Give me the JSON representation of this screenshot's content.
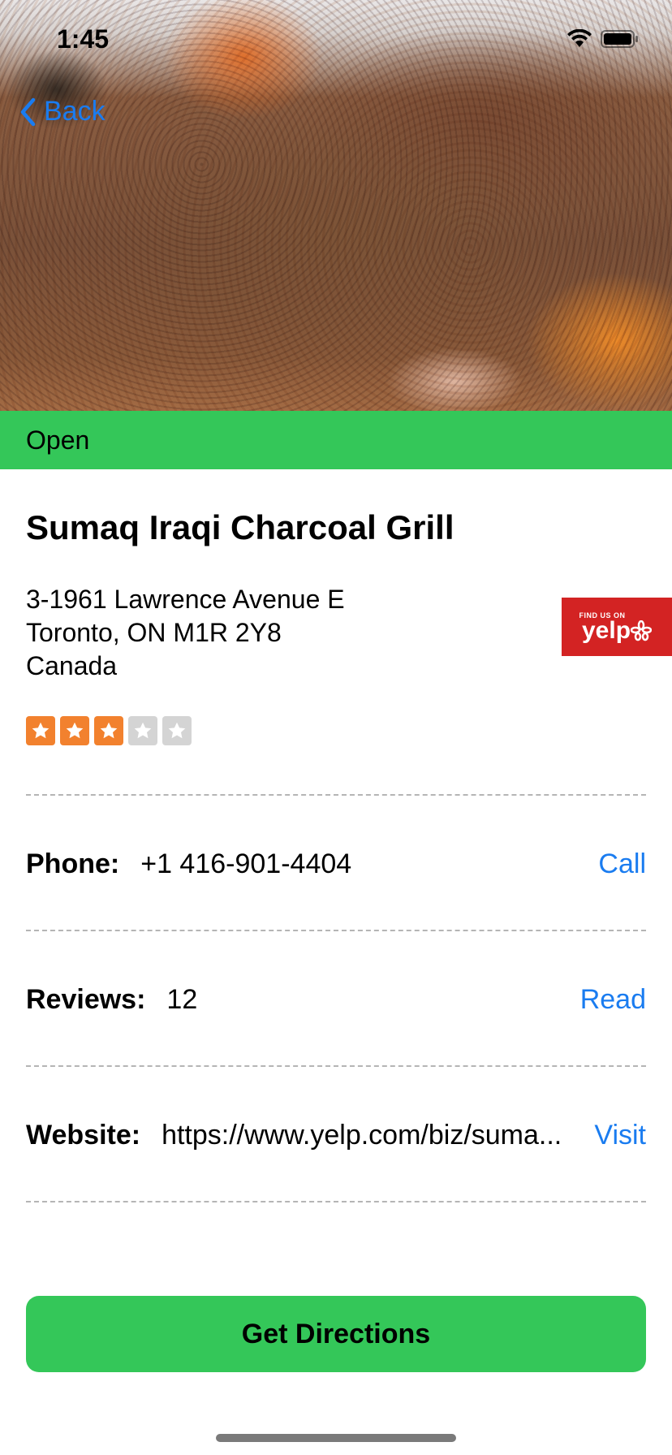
{
  "status_bar": {
    "time": "1:45"
  },
  "nav": {
    "back_label": "Back"
  },
  "business": {
    "status": "Open",
    "name": "Sumaq Iraqi Charcoal Grill",
    "address_line1": "3-1961 Lawrence Avenue E",
    "address_line2": "Toronto, ON M1R 2Y8",
    "address_line3": "Canada",
    "rating_stars": 3,
    "rating_max": 5,
    "yelp_badge": {
      "top": "FIND US ON",
      "brand": "yelp"
    }
  },
  "details": {
    "phone": {
      "label": "Phone:",
      "value": "+1 416-901-4404",
      "action": "Call"
    },
    "reviews": {
      "label": "Reviews:",
      "value": "12",
      "action": "Read"
    },
    "website": {
      "label": "Website:",
      "value": "https://www.yelp.com/biz/suma...",
      "action": "Visit"
    }
  },
  "primary_action": {
    "label": "Get Directions"
  },
  "colors": {
    "accent_green": "#34c759",
    "link_blue": "#1a7cf0",
    "yelp_red": "#d32323",
    "star_on": "#f2812e",
    "star_off": "#d4d4d4"
  }
}
